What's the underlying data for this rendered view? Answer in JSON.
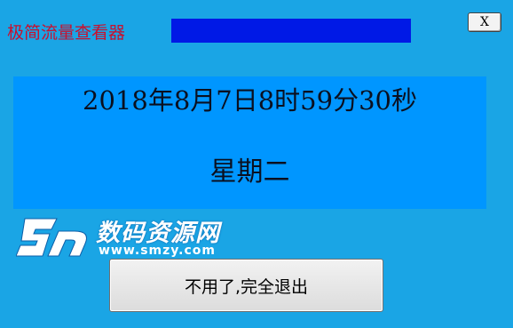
{
  "window": {
    "title": "极简流量查看器",
    "close_label": "X"
  },
  "clock": {
    "datetime": "2018年8月7日8时59分30秒",
    "weekday": "星期二"
  },
  "watermark": {
    "site_name": "数码资源网",
    "url": "www.smzy.com"
  },
  "actions": {
    "quit_label": "不用了,完全退出"
  },
  "colors": {
    "background": "#1AA5E5",
    "title_text": "#C8102E",
    "title_bar": "#0019E6",
    "clock_panel": "#0096FF"
  }
}
